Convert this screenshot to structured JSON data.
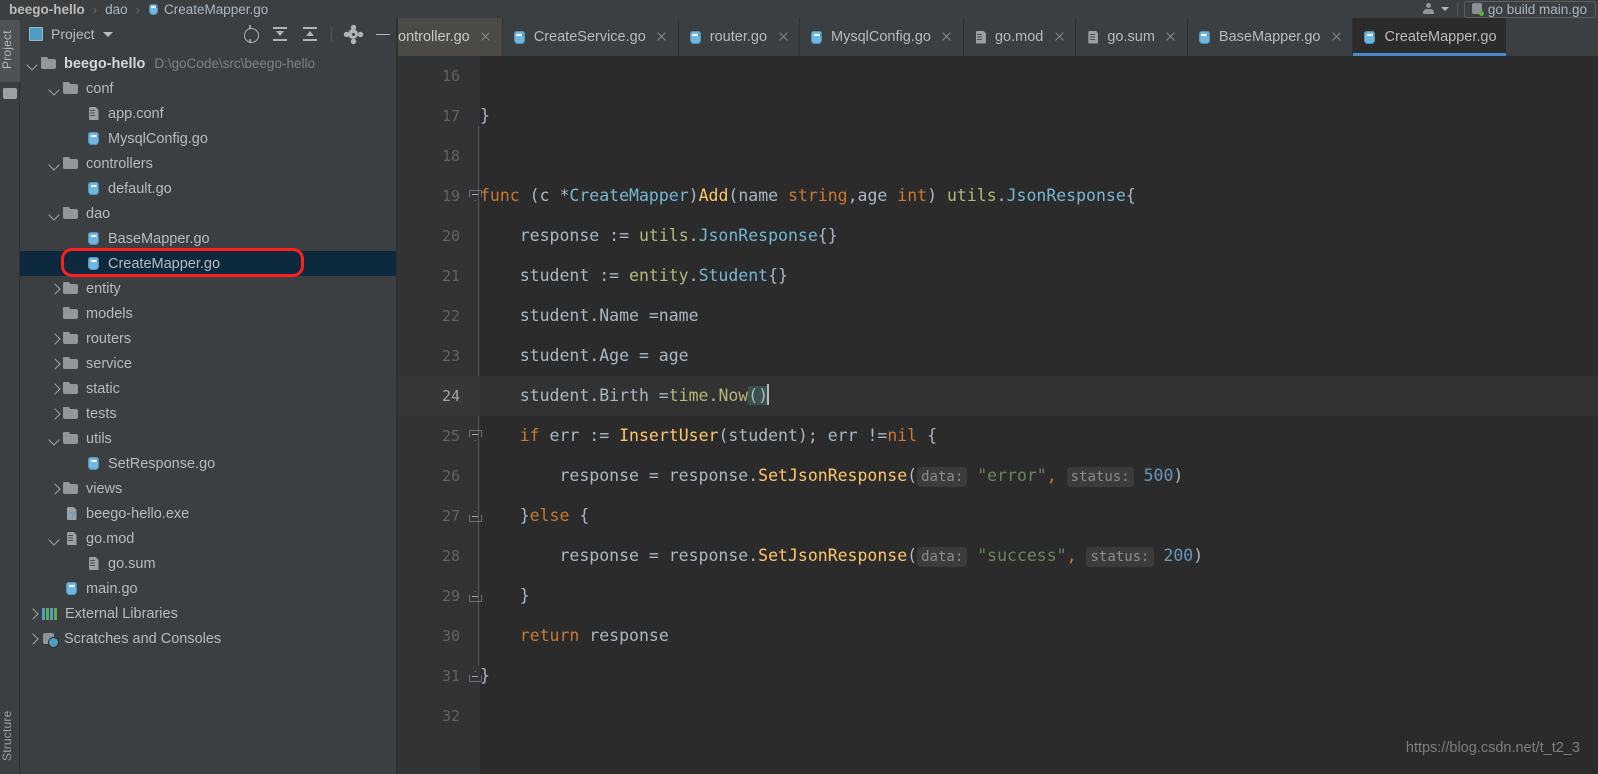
{
  "breadcrumb": {
    "project": "beego-hello",
    "folder": "dao",
    "file": "CreateMapper.go",
    "separator": "›"
  },
  "top_right": {
    "run_config_label": "go build main.go"
  },
  "tool_stripes": {
    "left_top": "Project",
    "left_bottom": "Structure"
  },
  "project_panel": {
    "title": "Project",
    "tools": [
      "locate-in-tree",
      "expand-all",
      "collapse-all",
      "settings",
      "hide"
    ],
    "tree": [
      {
        "indent": 0,
        "arrow": "down",
        "icon": "folder",
        "label": "beego-hello",
        "bold": true,
        "path": "D:\\goCode\\src\\beego-hello"
      },
      {
        "indent": 1,
        "arrow": "down",
        "icon": "folder",
        "label": "conf"
      },
      {
        "indent": 2,
        "arrow": "none",
        "icon": "doc",
        "label": "app.conf"
      },
      {
        "indent": 2,
        "arrow": "none",
        "icon": "gofile",
        "label": "MysqlConfig.go"
      },
      {
        "indent": 1,
        "arrow": "down",
        "icon": "folder",
        "label": "controllers"
      },
      {
        "indent": 2,
        "arrow": "none",
        "icon": "gofile",
        "label": "default.go"
      },
      {
        "indent": 1,
        "arrow": "down",
        "icon": "folder",
        "label": "dao"
      },
      {
        "indent": 2,
        "arrow": "none",
        "icon": "gofile",
        "label": "BaseMapper.go"
      },
      {
        "indent": 2,
        "arrow": "none",
        "icon": "gofile",
        "label": "CreateMapper.go",
        "selected": true,
        "annotated": true
      },
      {
        "indent": 1,
        "arrow": "right",
        "icon": "folder",
        "label": "entity"
      },
      {
        "indent": 1,
        "arrow": "none",
        "icon": "folder",
        "label": "models"
      },
      {
        "indent": 1,
        "arrow": "right",
        "icon": "folder",
        "label": "routers"
      },
      {
        "indent": 1,
        "arrow": "right",
        "icon": "folder",
        "label": "service"
      },
      {
        "indent": 1,
        "arrow": "right",
        "icon": "folder",
        "label": "static"
      },
      {
        "indent": 1,
        "arrow": "right",
        "icon": "folder",
        "label": "tests"
      },
      {
        "indent": 1,
        "arrow": "down",
        "icon": "folder",
        "label": "utils"
      },
      {
        "indent": 2,
        "arrow": "none",
        "icon": "gofile",
        "label": "SetResponse.go"
      },
      {
        "indent": 1,
        "arrow": "right",
        "icon": "folder",
        "label": "views"
      },
      {
        "indent": 1,
        "arrow": "none",
        "icon": "exe",
        "label": "beego-hello.exe"
      },
      {
        "indent": 1,
        "arrow": "down",
        "icon": "doc",
        "label": "go.mod"
      },
      {
        "indent": 2,
        "arrow": "none",
        "icon": "doc",
        "label": "go.sum"
      },
      {
        "indent": 1,
        "arrow": "none",
        "icon": "gofile",
        "label": "main.go"
      },
      {
        "indent": 0,
        "arrow": "right",
        "icon": "lib",
        "label": "External Libraries"
      },
      {
        "indent": 0,
        "arrow": "right",
        "icon": "scratch",
        "label": "Scratches and Consoles"
      }
    ]
  },
  "editor": {
    "tabs": [
      {
        "label": "ontroller.go",
        "icon": "none",
        "partial": true,
        "closable": true
      },
      {
        "label": "CreateService.go",
        "icon": "gofile",
        "closable": true
      },
      {
        "label": "router.go",
        "icon": "gofile",
        "closable": true
      },
      {
        "label": "MysqlConfig.go",
        "icon": "gofile",
        "closable": true
      },
      {
        "label": "go.mod",
        "icon": "doc",
        "closable": true
      },
      {
        "label": "go.sum",
        "icon": "doc",
        "closable": true
      },
      {
        "label": "BaseMapper.go",
        "icon": "gofile",
        "closable": true
      },
      {
        "label": "CreateMapper.go",
        "icon": "gofile",
        "active": true,
        "closable": false
      }
    ],
    "current_line": 24,
    "line_numbers": [
      16,
      17,
      18,
      19,
      20,
      21,
      22,
      23,
      24,
      25,
      26,
      27,
      28,
      29,
      30,
      31,
      32
    ],
    "lines": {
      "16": "",
      "17": "}",
      "19_parts": [
        "func ",
        "(c *",
        "CreateMapper",
        ")",
        "Add",
        "(name ",
        "string",
        ",age ",
        "int",
        ") ",
        "utils",
        ".",
        "JsonResponse",
        "{"
      ],
      "20": "    response := utils.JsonResponse{}",
      "21": "    student := entity.Student{}",
      "22": "    student.Name =name",
      "23": "    student.Age = age",
      "24": "    student.Birth =time.Now()",
      "25": "    if err := InsertUser(student); err !=nil {",
      "26_pre": "        response = response.SetJsonResponse(",
      "26_hint1": "data:",
      "26_str": "\"error\"",
      "26_hint2": "status:",
      "26_num": "500",
      "27": "    }else {",
      "28_pre": "        response = response.SetJsonResponse(",
      "28_hint1": "data:",
      "28_str": "\"success\"",
      "28_hint2": "status:",
      "28_num": "200",
      "29": "    }",
      "30": "    return response",
      "31": "}",
      "32": ""
    },
    "watermark": "https://blog.csdn.net/t_t2_3"
  },
  "colors": {
    "keyword": "#cc7832",
    "function": "#ffc66d",
    "class": "#77b7d4",
    "package": "#b5b87a",
    "string": "#6a8759",
    "number": "#6897bb",
    "default_text": "#a9b7c6",
    "editor_bg": "#2b2b2b",
    "panel_bg": "#3c3f41",
    "selection_bg": "#0d293e",
    "annotation": "#ff1f1f",
    "tab_underline": "#4a88c7"
  }
}
